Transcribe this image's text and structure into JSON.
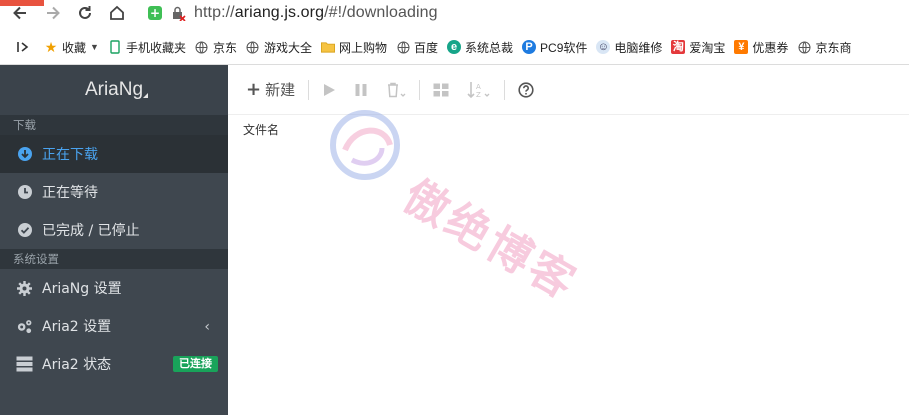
{
  "browser": {
    "url_prefix": "http://",
    "url_host": "ariang.js.org",
    "url_path": "/#!/downloading",
    "bookmarks": [
      {
        "label": "收藏",
        "icon": "star-icon"
      },
      {
        "label": "手机收藏夹",
        "icon": "phone-icon"
      },
      {
        "label": "京东",
        "icon": "globe-icon"
      },
      {
        "label": "游戏大全",
        "icon": "globe-icon"
      },
      {
        "label": "网上购物",
        "icon": "folder-icon"
      },
      {
        "label": "百度",
        "icon": "globe-icon"
      },
      {
        "label": "系统总裁",
        "icon": "e-icon"
      },
      {
        "label": "PC9软件",
        "icon": "p-icon"
      },
      {
        "label": "电脑维修",
        "icon": "avatar-icon"
      },
      {
        "label": "爱淘宝",
        "icon": "taobao-icon"
      },
      {
        "label": "优惠券",
        "icon": "coupon-icon"
      },
      {
        "label": "京东商",
        "icon": "globe-icon"
      }
    ]
  },
  "sidebar": {
    "brand": "AriaNg",
    "download_section": "下载",
    "downloading": "正在下载",
    "waiting": "正在等待",
    "stopped": "已完成 / 已停止",
    "settings_section": "系统设置",
    "ariang_settings": "AriaNg 设置",
    "aria2_settings": "Aria2 设置",
    "aria2_status": "Aria2 状态",
    "connected_badge": "已连接"
  },
  "toolbar": {
    "new_label": "新建"
  },
  "list": {
    "file_name_header": "文件名"
  },
  "watermark": {
    "text": "傲绝博客"
  },
  "colors": {
    "sidebar_bg": "#3f474f",
    "active_text": "#4aa3ef",
    "badge_bg": "#19a35a",
    "watermark": "#f2a8c8"
  }
}
